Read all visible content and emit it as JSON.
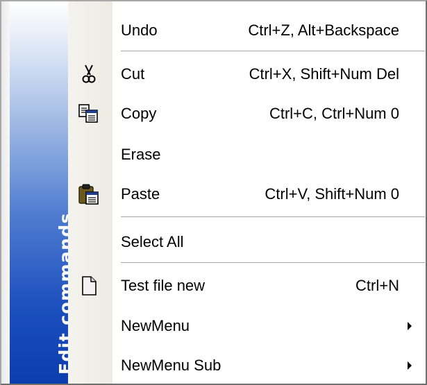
{
  "sidebar": {
    "title": "Edit commands"
  },
  "items": [
    {
      "label": "Undo",
      "shortcut": "Ctrl+Z, Alt+Backspace",
      "icon": "none"
    },
    {
      "label": "Cut",
      "shortcut": "Ctrl+X, Shift+Num Del",
      "icon": "scissors-icon"
    },
    {
      "label": "Copy",
      "shortcut": "Ctrl+C, Ctrl+Num 0",
      "icon": "copy-icon"
    },
    {
      "label": "Erase",
      "shortcut": "",
      "icon": "none"
    },
    {
      "label": "Paste",
      "shortcut": "Ctrl+V, Shift+Num 0",
      "icon": "clipboard-icon"
    },
    {
      "label": "Select All",
      "shortcut": "",
      "icon": "none"
    },
    {
      "label": "Test file new",
      "shortcut": "Ctrl+N",
      "icon": "document-icon"
    },
    {
      "label": "NewMenu",
      "shortcut": "",
      "icon": "none",
      "submenu": true
    },
    {
      "label": "NewMenu Sub",
      "shortcut": "",
      "icon": "none",
      "submenu": true
    }
  ],
  "colors": {
    "sidebar_top": "#ffffff",
    "sidebar_bottom": "#0b3daf",
    "icon_column": "#f1f0ea",
    "separator": "#a7a7a7"
  }
}
